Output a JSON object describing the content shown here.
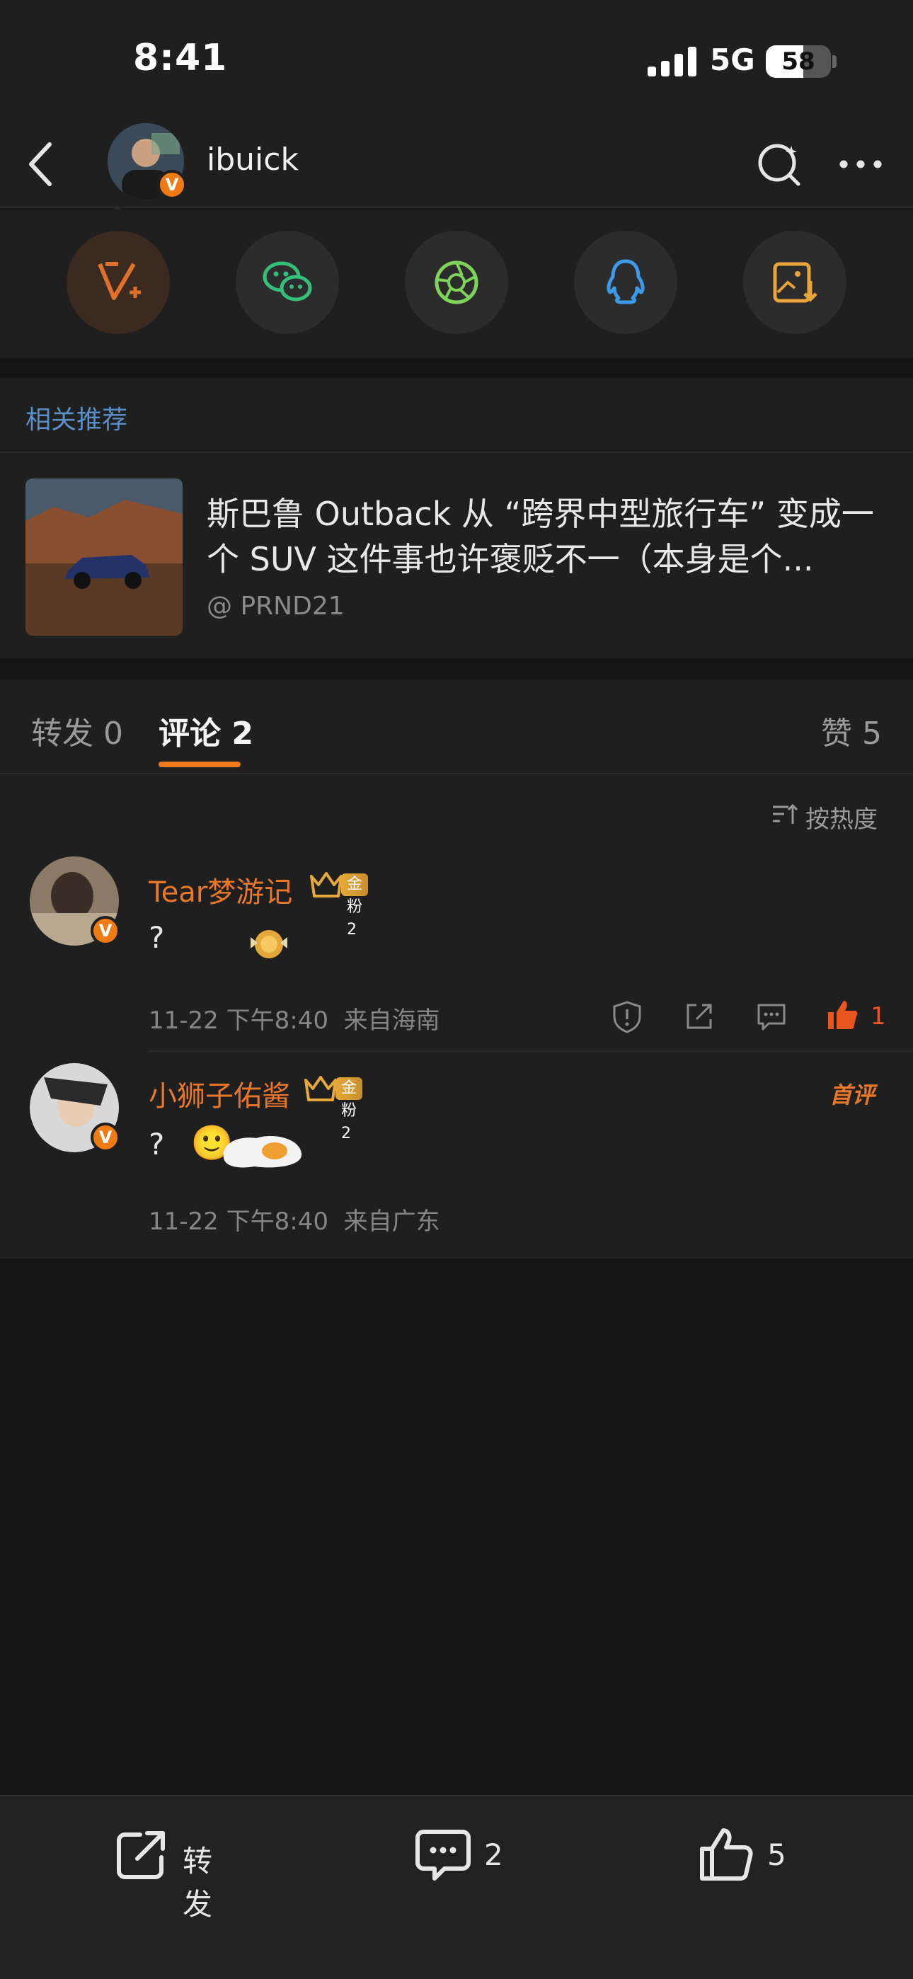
{
  "status_bar": {
    "time": "8:41",
    "network": "5G",
    "battery": "58",
    "battery_level": 0.58
  },
  "nav": {
    "user_name": "ibuick",
    "verified_mark": "V"
  },
  "share_targets": [
    {
      "name": "weibo-forward",
      "icon": "v-plus-icon",
      "color": "#e0712a"
    },
    {
      "name": "wechat",
      "icon": "wechat-icon",
      "color": "#35c07a"
    },
    {
      "name": "moments",
      "icon": "aperture-icon",
      "color": "#7fd35a"
    },
    {
      "name": "qq",
      "icon": "qq-penguin-icon",
      "color": "#3d9ae8"
    },
    {
      "name": "save-image",
      "icon": "image-download-icon",
      "color": "#e8a53a"
    }
  ],
  "recommend": {
    "header": "相关推荐",
    "title": "斯巴鲁 Outback 从 “跨界中型旅行车” 变成一个 SUV 这件事也许褒贬不一（本身是个...",
    "author": "@ PRND21"
  },
  "tabs": {
    "repost": "转发 0",
    "comment": "评论 2",
    "like": "赞 5"
  },
  "sort_label": "按热度",
  "comments": [
    {
      "name": "Tear梦游记",
      "badge": "金粉2",
      "text": "?",
      "time": "11-22  下午8:40",
      "location": "来自海南",
      "likes": "1"
    },
    {
      "name": "小狮子佑酱",
      "badge": "金粉2",
      "text": "?",
      "emoji": "🙂",
      "time": "11-22  下午8:40",
      "location": "来自广东",
      "tag": "首评"
    }
  ],
  "bottom_bar": {
    "repost": "转发",
    "comment_count": "2",
    "like_count": "5"
  },
  "colors": {
    "accent": "#f27a1a",
    "link_blue": "#5a8fc8",
    "username_orange": "#e8772a"
  }
}
